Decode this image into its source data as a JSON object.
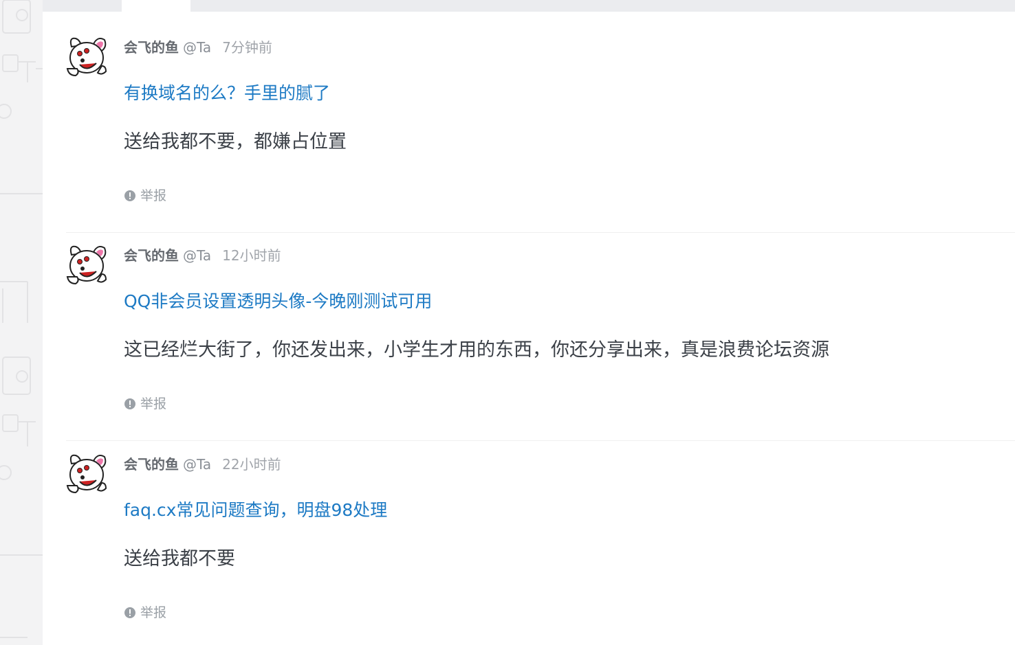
{
  "posts": [
    {
      "author": "会飞的鱼",
      "handle": "@Ta",
      "time": "7分钟前",
      "title": "有换域名的么？手里的腻了",
      "body": "送给我都不要，都嫌占位置",
      "report_label": "举报"
    },
    {
      "author": "会飞的鱼",
      "handle": "@Ta",
      "time": "12小时前",
      "title": "QQ非会员设置透明头像-今晚刚测试可用",
      "body": "这已经烂大街了，你还发出来，小学生才用的东西，你还分享出来，真是浪费论坛资源",
      "report_label": "举报"
    },
    {
      "author": "会飞的鱼",
      "handle": "@Ta",
      "time": "22小时前",
      "title": "faq.cx常见问题查询，明盘98处理",
      "body": "送给我都不要",
      "report_label": "举报"
    }
  ],
  "icons": {
    "report": "exclamation-circle-icon",
    "avatar": "cartoon-dog-avatar"
  },
  "colors": {
    "title_link": "#1d7ac4",
    "body_text": "#3b4047",
    "meta_text": "#a0a4aa"
  }
}
